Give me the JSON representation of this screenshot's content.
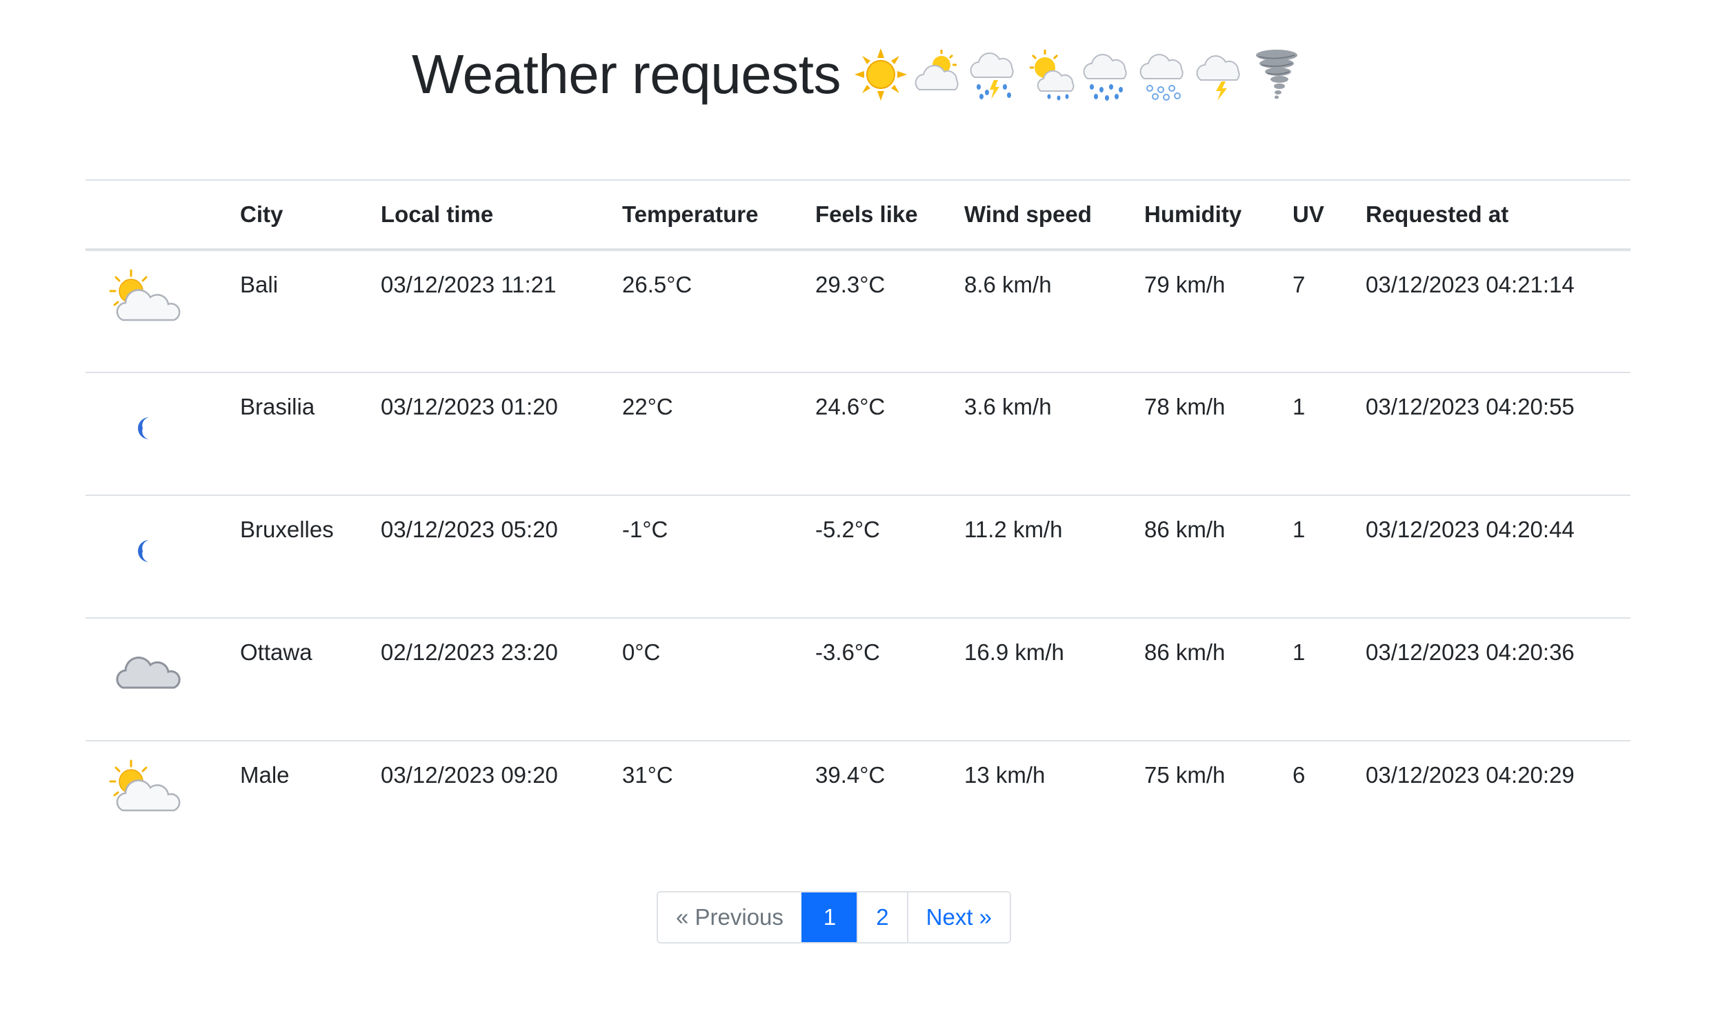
{
  "page": {
    "title": "Weather requests",
    "title_icons": [
      "sun-icon",
      "sun-behind-cloud-icon",
      "rain-thunder-cloud-icon",
      "sun-behind-rain-cloud-icon",
      "rain-cloud-icon",
      "snow-cloud-icon",
      "lightning-cloud-icon",
      "tornado-icon"
    ]
  },
  "table": {
    "headers": {
      "icon": "",
      "city": "City",
      "local_time": "Local time",
      "temperature": "Temperature",
      "feels_like": "Feels like",
      "wind_speed": "Wind speed",
      "humidity": "Humidity",
      "uv": "UV",
      "requested_at": "Requested at"
    },
    "rows": [
      {
        "icon": "partly-cloudy-icon",
        "city": "Bali",
        "local_time": "03/12/2023 11:21",
        "temperature": "26.5°C",
        "feels_like": "29.3°C",
        "wind_speed": "8.6 km/h",
        "humidity": "79 km/h",
        "uv": "7",
        "requested_at": "03/12/2023 04:21:14"
      },
      {
        "icon": "moon-icon",
        "city": "Brasilia",
        "local_time": "03/12/2023 01:20",
        "temperature": "22°C",
        "feels_like": "24.6°C",
        "wind_speed": "3.6 km/h",
        "humidity": "78 km/h",
        "uv": "1",
        "requested_at": "03/12/2023 04:20:55"
      },
      {
        "icon": "moon-icon",
        "city": "Bruxelles",
        "local_time": "03/12/2023 05:20",
        "temperature": "-1°C",
        "feels_like": "-5.2°C",
        "wind_speed": "11.2 km/h",
        "humidity": "86 km/h",
        "uv": "1",
        "requested_at": "03/12/2023 04:20:44"
      },
      {
        "icon": "cloud-icon",
        "city": "Ottawa",
        "local_time": "02/12/2023 23:20",
        "temperature": "0°C",
        "feels_like": "-3.6°C",
        "wind_speed": "16.9 km/h",
        "humidity": "86 km/h",
        "uv": "1",
        "requested_at": "03/12/2023 04:20:36"
      },
      {
        "icon": "partly-cloudy-icon",
        "city": "Male",
        "local_time": "03/12/2023 09:20",
        "temperature": "31°C",
        "feels_like": "39.4°C",
        "wind_speed": "13 km/h",
        "humidity": "75 km/h",
        "uv": "6",
        "requested_at": "03/12/2023 04:20:29"
      }
    ]
  },
  "pagination": {
    "previous": "« Previous",
    "pages": [
      "1",
      "2"
    ],
    "active_page": "1",
    "next": "Next »"
  },
  "colors": {
    "accent": "#0d6efd",
    "border": "#dee2e6",
    "text": "#212529",
    "muted": "#6c757d",
    "moon": "#2f6bd8"
  }
}
